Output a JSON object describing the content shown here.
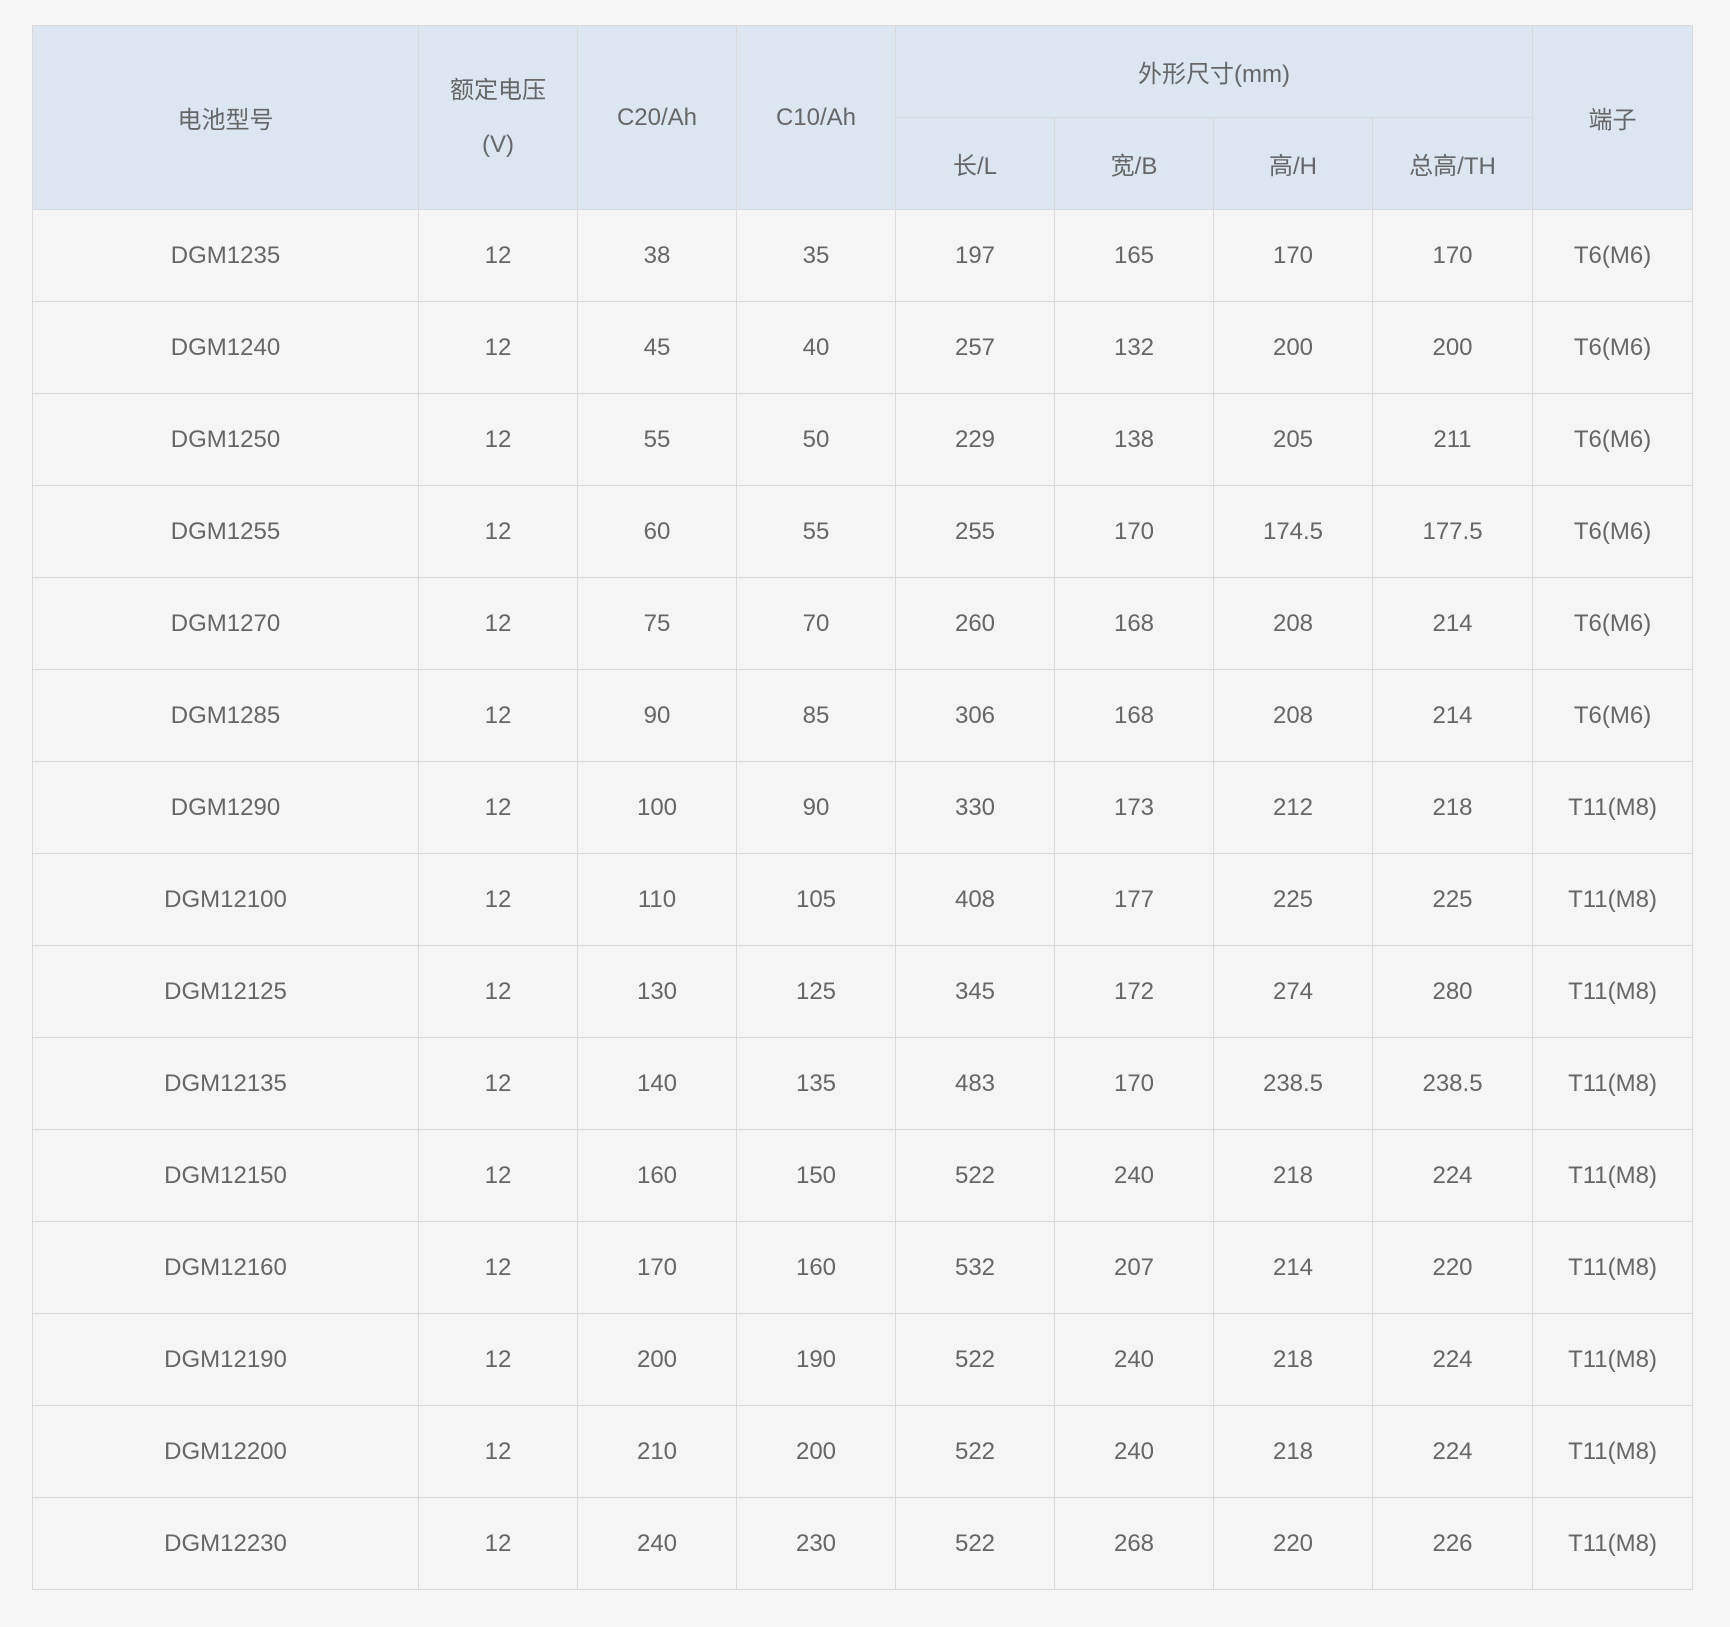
{
  "table": {
    "headers": {
      "model": "电池型号",
      "voltage_line1": "额定电压",
      "voltage_line2": "(V)",
      "c20": "C20/Ah",
      "c10": "C10/Ah",
      "dimensions": "外形尺寸(mm)",
      "length": "长/L",
      "width": "宽/B",
      "height": "高/H",
      "total_height": "总高/TH",
      "terminal": "端子"
    },
    "rows": [
      [
        "DGM1235",
        "12",
        "38",
        "35",
        "197",
        "165",
        "170",
        "170",
        "T6(M6)"
      ],
      [
        "DGM1240",
        "12",
        "45",
        "40",
        "257",
        "132",
        "200",
        "200",
        "T6(M6)"
      ],
      [
        "DGM1250",
        "12",
        "55",
        "50",
        "229",
        "138",
        "205",
        "211",
        "T6(M6)"
      ],
      [
        "DGM1255",
        "12",
        "60",
        "55",
        "255",
        "170",
        "174.5",
        "177.5",
        "T6(M6)"
      ],
      [
        "DGM1270",
        "12",
        "75",
        "70",
        "260",
        "168",
        "208",
        "214",
        "T6(M6)"
      ],
      [
        "DGM1285",
        "12",
        "90",
        "85",
        "306",
        "168",
        "208",
        "214",
        "T6(M6)"
      ],
      [
        "DGM1290",
        "12",
        "100",
        "90",
        "330",
        "173",
        "212",
        "218",
        "T11(M8)"
      ],
      [
        "DGM12100",
        "12",
        "110",
        "105",
        "408",
        "177",
        "225",
        "225",
        "T11(M8)"
      ],
      [
        "DGM12125",
        "12",
        "130",
        "125",
        "345",
        "172",
        "274",
        "280",
        "T11(M8)"
      ],
      [
        "DGM12135",
        "12",
        "140",
        "135",
        "483",
        "170",
        "238.5",
        "238.5",
        "T11(M8)"
      ],
      [
        "DGM12150",
        "12",
        "160",
        "150",
        "522",
        "240",
        "218",
        "224",
        "T11(M8)"
      ],
      [
        "DGM12160",
        "12",
        "170",
        "160",
        "532",
        "207",
        "214",
        "220",
        "T11(M8)"
      ],
      [
        "DGM12190",
        "12",
        "200",
        "190",
        "522",
        "240",
        "218",
        "224",
        "T11(M8)"
      ],
      [
        "DGM12200",
        "12",
        "210",
        "200",
        "522",
        "240",
        "218",
        "224",
        "T11(M8)"
      ],
      [
        "DGM12230",
        "12",
        "240",
        "230",
        "522",
        "268",
        "220",
        "226",
        "T11(M8)"
      ]
    ]
  },
  "colors": {
    "header_bg": "#dce6f1",
    "body_bg": "#f5f5f5",
    "border": "#d9d9d9",
    "text": "#666666"
  }
}
